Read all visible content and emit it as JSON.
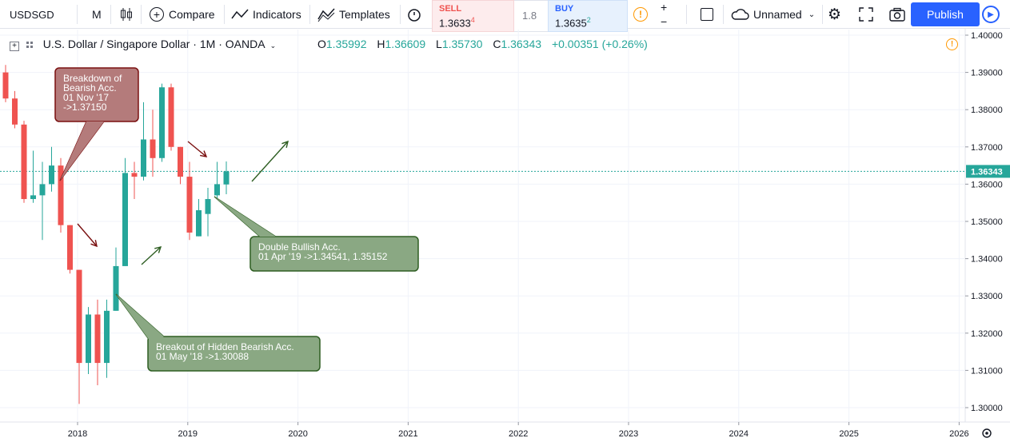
{
  "toolbar": {
    "symbol": "USDSGD",
    "interval": "M",
    "compare_label": "Compare",
    "indicators_label": "Indicators",
    "templates_label": "Templates",
    "sell_label": "SELL",
    "sell_price": "1.3633",
    "sell_super": "4",
    "spread": "1.8",
    "buy_label": "BUY",
    "buy_price": "1.3635",
    "buy_super": "2",
    "plus": "+",
    "minus": "−",
    "layout_name": "Unnamed",
    "publish_label": "Publish"
  },
  "legend": {
    "title": "U.S. Dollar / Singapore Dollar · 1M · OANDA",
    "o_label": "O",
    "o_value": "1.35992",
    "h_label": "H",
    "h_value": "1.36609",
    "l_label": "L",
    "l_value": "1.35730",
    "c_label": "C",
    "c_value": "1.36343",
    "change": "+0.00351 (+0.26%)"
  },
  "colors": {
    "up": "#26a69a",
    "down": "#ef5350",
    "accent": "#2962ff",
    "last_price": "#26a69a"
  },
  "annotations": [
    {
      "lines": [
        "Breakdown of",
        "Bearish Acc.",
        "01 Nov '17",
        "->1.37150"
      ],
      "fill": "#b47b7b",
      "stroke": "#7a1010"
    },
    {
      "lines": [
        "Double Bullish Acc.",
        "01 Apr '19 ->1.34541, 1.35152"
      ],
      "fill": "#8aa883",
      "stroke": "#2e5e22"
    },
    {
      "lines": [
        "Breakout of Hidden Bearish Acc.",
        "01 May '18 ->1.30088"
      ],
      "fill": "#8aa883",
      "stroke": "#2e5e22"
    }
  ],
  "chart_data": {
    "type": "candlestick",
    "symbol": "USDSGD",
    "interval": "1M",
    "y_axis_ticks": [
      "1.40000",
      "1.39000",
      "1.38000",
      "1.37000",
      "1.36000",
      "1.35000",
      "1.34000",
      "1.33000",
      "1.32000",
      "1.31000",
      "1.30000"
    ],
    "x_axis_ticks": [
      "2018",
      "2019",
      "2020",
      "2021",
      "2022",
      "2023",
      "2024",
      "2025",
      "2026"
    ],
    "last_price": "1.36343",
    "ylim": [
      1.2975,
      1.4005
    ],
    "candles": [
      {
        "date": "2017-05",
        "o": 1.39,
        "h": 1.392,
        "l": 1.382,
        "c": 1.383
      },
      {
        "date": "2017-06",
        "o": 1.383,
        "h": 1.385,
        "l": 1.375,
        "c": 1.376
      },
      {
        "date": "2017-07",
        "o": 1.376,
        "h": 1.377,
        "l": 1.355,
        "c": 1.356
      },
      {
        "date": "2017-08",
        "o": 1.356,
        "h": 1.369,
        "l": 1.355,
        "c": 1.357
      },
      {
        "date": "2017-09",
        "o": 1.357,
        "h": 1.366,
        "l": 1.345,
        "c": 1.36
      },
      {
        "date": "2017-10",
        "o": 1.36,
        "h": 1.37,
        "l": 1.358,
        "c": 1.365
      },
      {
        "date": "2017-11",
        "o": 1.365,
        "h": 1.367,
        "l": 1.347,
        "c": 1.349
      },
      {
        "date": "2017-12",
        "o": 1.349,
        "h": 1.349,
        "l": 1.336,
        "c": 1.337
      },
      {
        "date": "2018-01",
        "o": 1.337,
        "h": 1.337,
        "l": 1.301,
        "c": 1.312
      },
      {
        "date": "2018-02",
        "o": 1.312,
        "h": 1.327,
        "l": 1.309,
        "c": 1.325
      },
      {
        "date": "2018-03",
        "o": 1.325,
        "h": 1.329,
        "l": 1.306,
        "c": 1.312
      },
      {
        "date": "2018-04",
        "o": 1.312,
        "h": 1.329,
        "l": 1.308,
        "c": 1.326
      },
      {
        "date": "2018-05",
        "o": 1.326,
        "h": 1.343,
        "l": 1.326,
        "c": 1.338
      },
      {
        "date": "2018-06",
        "o": 1.338,
        "h": 1.367,
        "l": 1.338,
        "c": 1.363
      },
      {
        "date": "2018-07",
        "o": 1.363,
        "h": 1.366,
        "l": 1.356,
        "c": 1.362
      },
      {
        "date": "2018-08",
        "o": 1.362,
        "h": 1.382,
        "l": 1.361,
        "c": 1.372
      },
      {
        "date": "2018-09",
        "o": 1.372,
        "h": 1.38,
        "l": 1.362,
        "c": 1.367
      },
      {
        "date": "2018-10",
        "o": 1.367,
        "h": 1.387,
        "l": 1.366,
        "c": 1.386
      },
      {
        "date": "2018-11",
        "o": 1.386,
        "h": 1.387,
        "l": 1.369,
        "c": 1.37
      },
      {
        "date": "2018-12",
        "o": 1.37,
        "h": 1.37,
        "l": 1.36,
        "c": 1.362
      },
      {
        "date": "2019-01",
        "o": 1.362,
        "h": 1.366,
        "l": 1.345,
        "c": 1.347
      },
      {
        "date": "2019-02",
        "o": 1.346,
        "h": 1.356,
        "l": 1.346,
        "c": 1.353
      },
      {
        "date": "2019-03",
        "o": 1.352,
        "h": 1.359,
        "l": 1.346,
        "c": 1.356
      },
      {
        "date": "2019-04",
        "o": 1.357,
        "h": 1.366,
        "l": 1.356,
        "c": 1.36
      },
      {
        "date": "2019-05",
        "o": 1.35992,
        "h": 1.36609,
        "l": 1.3573,
        "c": 1.36343
      }
    ]
  }
}
